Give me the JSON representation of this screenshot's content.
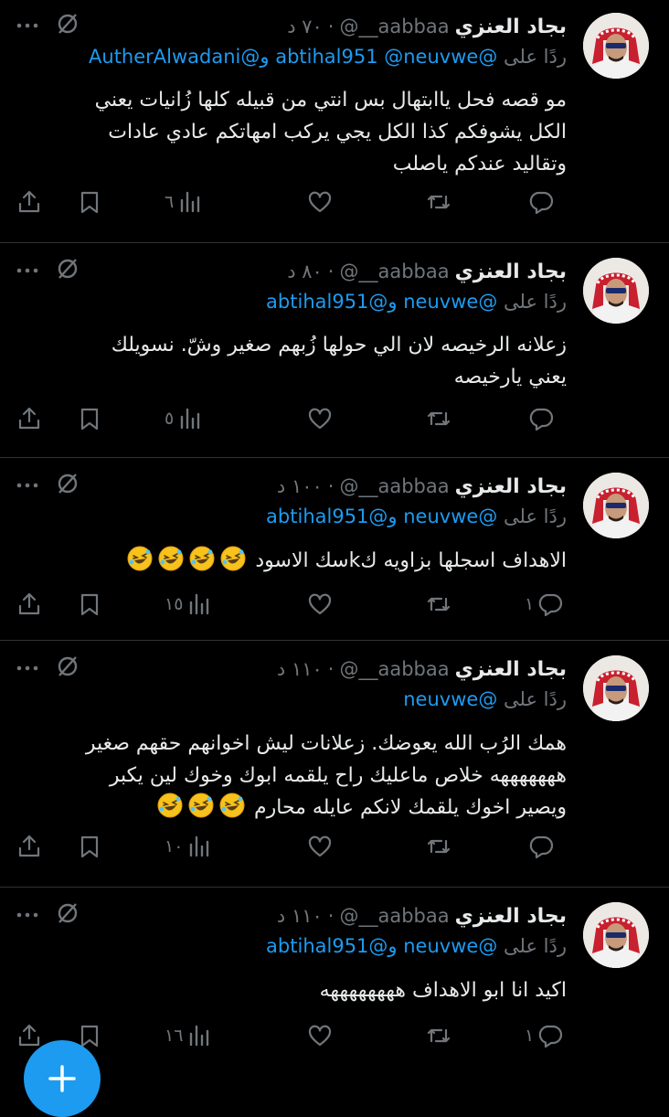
{
  "tweets": [
    {
      "name": "بجاد العنزي",
      "handle": "@__aabbaa",
      "time": "٧٠ د",
      "reply_label": "ردًا على",
      "mentions": "@abtihal951 @neuvwe و@AutherAlwadani",
      "lines": [
        "مو قصه فحل ياابتهال بس انتي من قبيله كلها زُانيات يعني",
        "الكل يشوفكم كذا الكل يجي يركب امهاتكم عادي عادات",
        "وتقاليد عندكم ياصلب"
      ],
      "emoji_count": 0,
      "replies": "",
      "views": "٦"
    },
    {
      "name": "بجاد العنزي",
      "handle": "@__aabbaa",
      "time": "٨٠ د",
      "reply_label": "ردًا على",
      "mentions": "@neuvwe و@abtihal951",
      "lines": [
        "زعلانه الرخيصه لان الي حولها زُبهم صغير وشّ. نسويلك",
        "يعني يارخيصه"
      ],
      "emoji_count": 0,
      "replies": "",
      "views": "٥"
    },
    {
      "name": "بجاد العنزي",
      "handle": "@__aabbaa",
      "time": "١٠٠ د",
      "reply_label": "ردًا على",
      "mentions": "@neuvwe و@abtihal951",
      "lines": [
        "الاهداف اسجلها بزاويه كkسك الاسود"
      ],
      "emoji_count": 4,
      "replies": "١",
      "views": "١٥"
    },
    {
      "name": "بجاد العنزي",
      "handle": "@__aabbaa",
      "time": "١١٠ د",
      "reply_label": "ردًا على",
      "mentions": "@neuvwe",
      "lines": [
        "همك الرُب الله يعوضك. زعلانات ليش اخوانهم حقهم صغير",
        "هههههههه  خلاص ماعليك راح يلقمه ابوك وخوك لين يكبر",
        "ويصير اخوك يلقمك لانكم عايله محارم"
      ],
      "emoji_count": 3,
      "replies": "",
      "views": "١٠"
    },
    {
      "name": "بجاد العنزي",
      "handle": "@__aabbaa",
      "time": "١١٠ د",
      "reply_label": "ردًا على",
      "mentions": "@neuvwe و@abtihal951",
      "lines": [
        "اكيد انا ابو الاهداف ههههههههه"
      ],
      "emoji_count": 0,
      "replies": "١",
      "views": "١٦"
    }
  ],
  "icons": {
    "more": "more-icon",
    "no_view": "no-view-icon",
    "reply": "reply-icon",
    "retweet": "retweet-icon",
    "like": "like-icon",
    "views": "views-icon",
    "bookmark": "bookmark-icon",
    "share": "share-icon",
    "compose": "compose-plus-icon",
    "emoji": "rolling-laughing-emoji"
  },
  "colors": {
    "background": "#000000",
    "text": "#e7e9ea",
    "muted": "#71767b",
    "accent": "#1d9bf0",
    "divider": "#2f3336"
  }
}
